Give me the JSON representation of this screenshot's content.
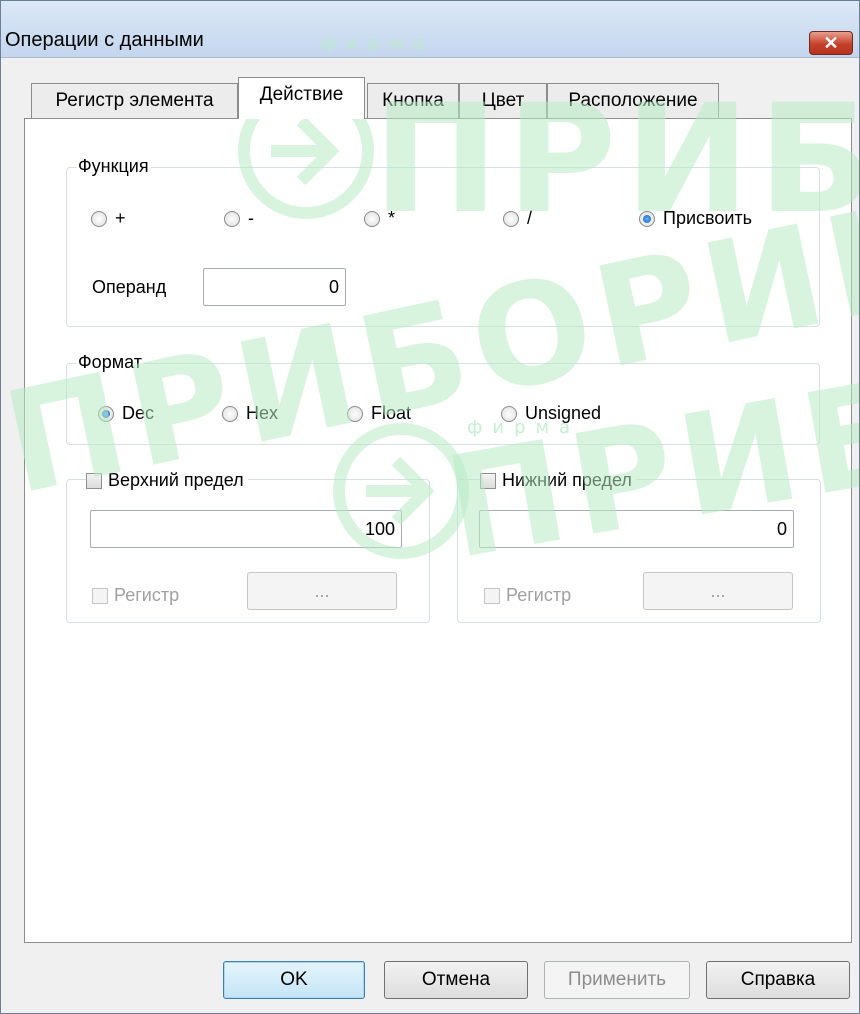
{
  "window": {
    "title": "Операции с данными"
  },
  "tabs": [
    {
      "label": "Регистр элемента"
    },
    {
      "label": "Действие"
    },
    {
      "label": "Кнопка"
    },
    {
      "label": "Цвет"
    },
    {
      "label": "Расположение"
    }
  ],
  "function_group": {
    "legend": "Функция",
    "options": [
      {
        "label": "+"
      },
      {
        "label": "-"
      },
      {
        "label": "*"
      },
      {
        "label": "/"
      },
      {
        "label": "Присвоить"
      }
    ],
    "selected": "Присвоить",
    "operand_label": "Операнд",
    "operand_value": "0"
  },
  "format_group": {
    "legend": "Формат",
    "options": [
      {
        "label": "Dec"
      },
      {
        "label": "Hex"
      },
      {
        "label": "Float"
      },
      {
        "label": "Unsigned"
      }
    ],
    "selected": "Dec"
  },
  "upper_limit": {
    "label": "Верхний предел",
    "value": "100",
    "register_label": "Регистр",
    "browse_label": "..."
  },
  "lower_limit": {
    "label": "Нижний предел",
    "value": "0",
    "register_label": "Регистр",
    "browse_label": "..."
  },
  "buttons": {
    "ok": "OK",
    "cancel": "Отмена",
    "apply": "Применить",
    "help": "Справка"
  },
  "watermark": {
    "brand": "ПРИБОРИКА",
    "small": "фирма"
  },
  "colors": {
    "selected_radio": "#1b5fb3",
    "watermark": "#b9ecc6",
    "close_button": "#c5412a"
  }
}
